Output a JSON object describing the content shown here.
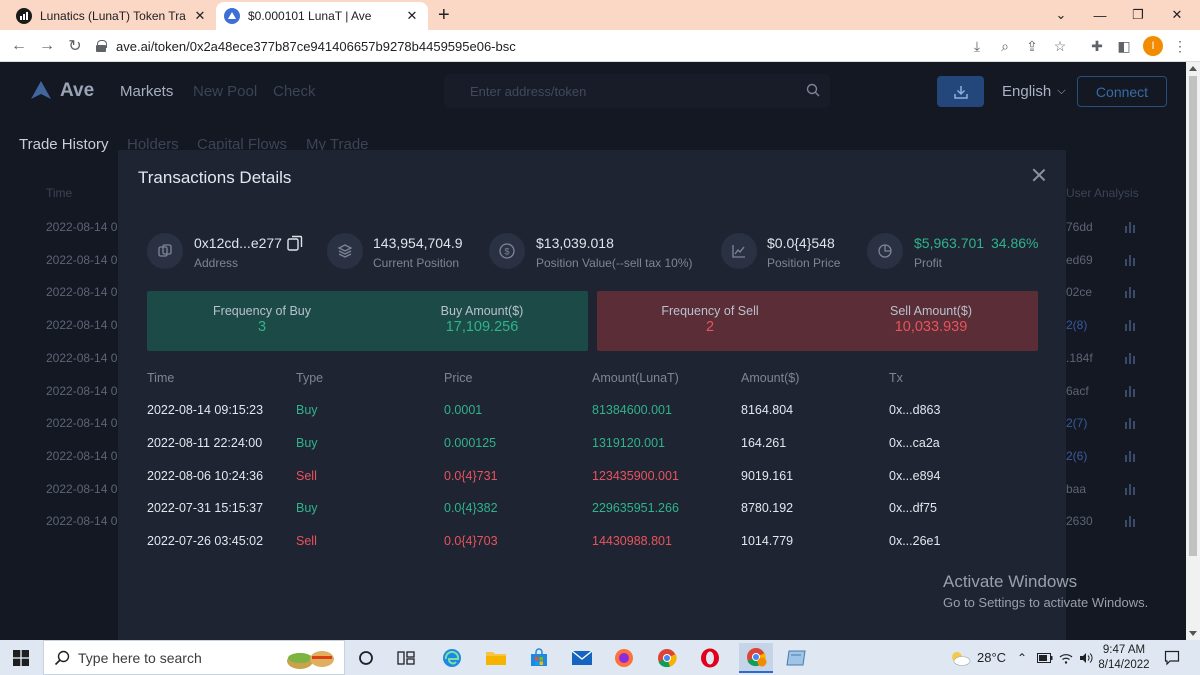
{
  "browser": {
    "tabs": [
      {
        "title": "Lunatics (LunaT) Token Tracker | B",
        "active": false
      },
      {
        "title": "$0.000101 LunaT | Ave",
        "active": true
      }
    ],
    "url": "ave.ai/token/0x2a48ece377b87ce941406657b9278b4459595e06-bsc",
    "profile_initial": "I"
  },
  "site": {
    "brand": "Ave",
    "nav": [
      "Markets",
      "New Pool",
      "Check"
    ],
    "search_placeholder": "Enter address/token",
    "language": "English",
    "connect_label": "Connect",
    "subtabs": [
      "Trade History",
      "Holders",
      "Capital Flows",
      "My Trade"
    ],
    "bg_header_time": "Time",
    "bg_header_user": "User Analysis",
    "bg_rows": [
      {
        "time": "2022-08-14 0",
        "hash": "76dd",
        "link": false
      },
      {
        "time": "2022-08-14 0",
        "hash": "ed69",
        "link": false
      },
      {
        "time": "2022-08-14 0",
        "hash": "02ce",
        "link": false
      },
      {
        "time": "2022-08-14 0",
        "hash": "2(8)",
        "link": true
      },
      {
        "time": "2022-08-14 0",
        "hash": ".184f",
        "link": false
      },
      {
        "time": "2022-08-14 0",
        "hash": "6acf",
        "link": false
      },
      {
        "time": "2022-08-14 0",
        "hash": "2(7)",
        "link": true
      },
      {
        "time": "2022-08-14 0",
        "hash": "2(6)",
        "link": true
      },
      {
        "time": "2022-08-14 0",
        "hash": "baa",
        "link": false
      },
      {
        "time": "2022-08-14 0",
        "hash": "2630",
        "link": false
      }
    ]
  },
  "modal": {
    "title": "Transactions Details",
    "address": {
      "value": "0x12cd...e277",
      "label": "Address"
    },
    "position": {
      "value": "143,954,704.9",
      "label": "Current Position"
    },
    "position_value": {
      "value": "$13,039.018",
      "label": "Position Value(--sell tax 10%)"
    },
    "position_price": {
      "value": "$0.0{4}548",
      "label": "Position Price"
    },
    "profit": {
      "value": "$5,963.701",
      "percent": "34.86%",
      "label": "Profit"
    },
    "buy_card": {
      "freq_label": "Frequency of Buy",
      "freq": "3",
      "amount_label": "Buy Amount($)",
      "amount": "17,109.256"
    },
    "sell_card": {
      "freq_label": "Frequency of Sell",
      "freq": "2",
      "amount_label": "Sell Amount($)",
      "amount": "10,033.939"
    },
    "columns": [
      "Time",
      "Type",
      "Price",
      "Amount(LunaT)",
      "Amount($)",
      "Tx"
    ],
    "rows": [
      {
        "time": "2022-08-14 09:15:23",
        "type": "Buy",
        "price": "0.0001",
        "amount_token": "81384600.001",
        "amount_usd": "8164.804",
        "tx": "0x...d863"
      },
      {
        "time": "2022-08-11 22:24:00",
        "type": "Buy",
        "price": "0.000125",
        "amount_token": "1319120.001",
        "amount_usd": "164.261",
        "tx": "0x...ca2a"
      },
      {
        "time": "2022-08-06 10:24:36",
        "type": "Sell",
        "price": "0.0{4}731",
        "amount_token": "123435900.001",
        "amount_usd": "9019.161",
        "tx": "0x...e894"
      },
      {
        "time": "2022-07-31 15:15:37",
        "type": "Buy",
        "price": "0.0{4}382",
        "amount_token": "229635951.266",
        "amount_usd": "8780.192",
        "tx": "0x...df75"
      },
      {
        "time": "2022-07-26 03:45:02",
        "type": "Sell",
        "price": "0.0{4}703",
        "amount_token": "14430988.801",
        "amount_usd": "1014.779",
        "tx": "0x...26e1"
      }
    ]
  },
  "windows_watermark": {
    "line1": "Activate Windows",
    "line2": "Go to Settings to activate Windows."
  },
  "taskbar": {
    "search_placeholder": "Type here to search",
    "temperature": "28°C",
    "time": "9:47 AM",
    "date": "8/14/2022"
  },
  "colors": {
    "buy": "#2fb38b",
    "sell": "#e8535d",
    "accent": "#3a6aa8"
  }
}
